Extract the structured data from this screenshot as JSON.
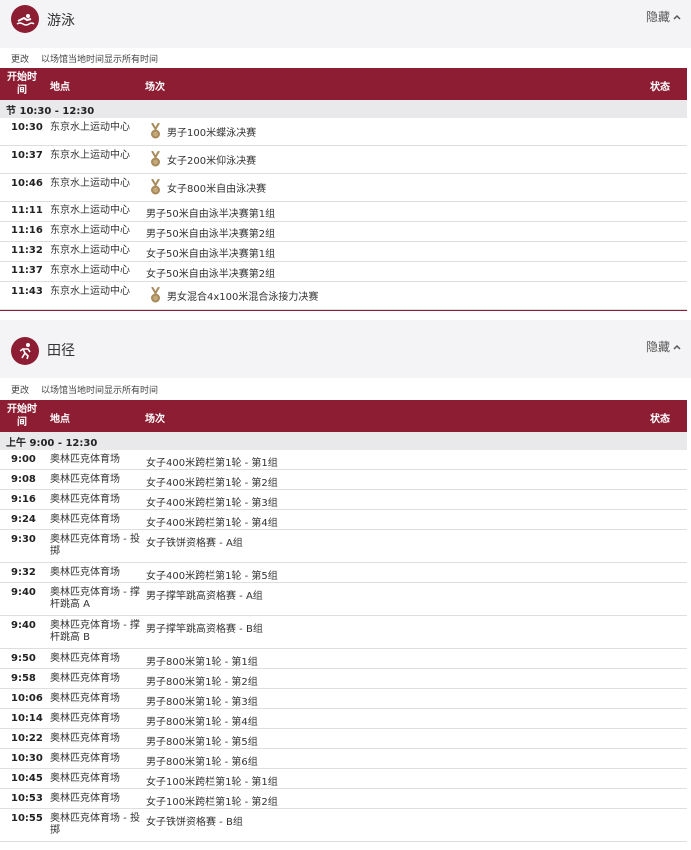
{
  "swimming": {
    "title": "游泳",
    "icon": "swimming-icon",
    "hide_label": "隐藏",
    "change_label": "更改",
    "note": "以场馆当地时间显示所有时间",
    "columns": {
      "time": "开始时间",
      "venue": "地点",
      "event": "场次",
      "status": "状态"
    },
    "session": "节 10:30 - 12:30",
    "rows": [
      {
        "time": "10:30",
        "venue": "东京水上运动中心",
        "event": "男子100米蝶泳决赛",
        "medal": true
      },
      {
        "time": "10:37",
        "venue": "东京水上运动中心",
        "event": "女子200米仰泳决赛",
        "medal": true
      },
      {
        "time": "10:46",
        "venue": "东京水上运动中心",
        "event": "女子800米自由泳决赛",
        "medal": true
      },
      {
        "time": "11:11",
        "venue": "东京水上运动中心",
        "event": "男子50米自由泳半决赛第1组",
        "medal": false
      },
      {
        "time": "11:16",
        "venue": "东京水上运动中心",
        "event": "男子50米自由泳半决赛第2组",
        "medal": false
      },
      {
        "time": "11:32",
        "venue": "东京水上运动中心",
        "event": "女子50米自由泳半决赛第1组",
        "medal": false
      },
      {
        "time": "11:37",
        "venue": "东京水上运动中心",
        "event": "女子50米自由泳半决赛第2组",
        "medal": false
      },
      {
        "time": "11:43",
        "venue": "东京水上运动中心",
        "event": "男女混合4x100米混合泳接力决赛",
        "medal": true
      }
    ]
  },
  "athletics": {
    "title": "田径",
    "icon": "running-icon",
    "hide_label": "隐藏",
    "change_label": "更改",
    "note": "以场馆当地时间显示所有时间",
    "columns": {
      "time": "开始时间",
      "venue": "地点",
      "event": "场次",
      "status": "状态"
    },
    "session": "上午 9:00 - 12:30",
    "rows": [
      {
        "time": "9:00",
        "venue": "奥林匹克体育场",
        "event": "女子400米跨栏第1轮 - 第1组"
      },
      {
        "time": "9:08",
        "venue": "奥林匹克体育场",
        "event": "女子400米跨栏第1轮 - 第2组"
      },
      {
        "time": "9:16",
        "venue": "奥林匹克体育场",
        "event": "女子400米跨栏第1轮 - 第3组"
      },
      {
        "time": "9:24",
        "venue": "奥林匹克体育场",
        "event": "女子400米跨栏第1轮 - 第4组"
      },
      {
        "time": "9:30",
        "venue": "奥林匹克体育场 - 投掷",
        "event": "女子铁饼资格赛 - A组"
      },
      {
        "time": "9:32",
        "venue": "奥林匹克体育场",
        "event": "女子400米跨栏第1轮 - 第5组"
      },
      {
        "time": "9:40",
        "venue": "奥林匹克体育场 - 撑杆跳高 A",
        "event": "男子撑竿跳高资格赛 - A组"
      },
      {
        "time": "9:40",
        "venue": "奥林匹克体育场 - 撑杆跳高 B",
        "event": "男子撑竿跳高资格赛 - B组"
      },
      {
        "time": "9:50",
        "venue": "奥林匹克体育场",
        "event": "男子800米第1轮 - 第1组"
      },
      {
        "time": "9:58",
        "venue": "奥林匹克体育场",
        "event": "男子800米第1轮 - 第2组"
      },
      {
        "time": "10:06",
        "venue": "奥林匹克体育场",
        "event": "男子800米第1轮 - 第3组"
      },
      {
        "time": "10:14",
        "venue": "奥林匹克体育场",
        "event": "男子800米第1轮 - 第4组"
      },
      {
        "time": "10:22",
        "venue": "奥林匹克体育场",
        "event": "男子800米第1轮 - 第5组"
      },
      {
        "time": "10:30",
        "venue": "奥林匹克体育场",
        "event": "男子800米第1轮 - 第6组"
      },
      {
        "time": "10:45",
        "venue": "奥林匹克体育场",
        "event": "女子100米跨栏第1轮 - 第1组"
      },
      {
        "time": "10:53",
        "venue": "奥林匹克体育场",
        "event": "女子100米跨栏第1轮 - 第2组"
      },
      {
        "time": "10:55",
        "venue": "奥林匹克体育场 - 投掷",
        "event": "女子铁饼资格赛 - B组"
      }
    ]
  },
  "colors": {
    "brand": "#8c1d33",
    "session_bg": "#e9e9ec",
    "header_bg": "#f4f4f6",
    "medal": "#a88a5c"
  }
}
